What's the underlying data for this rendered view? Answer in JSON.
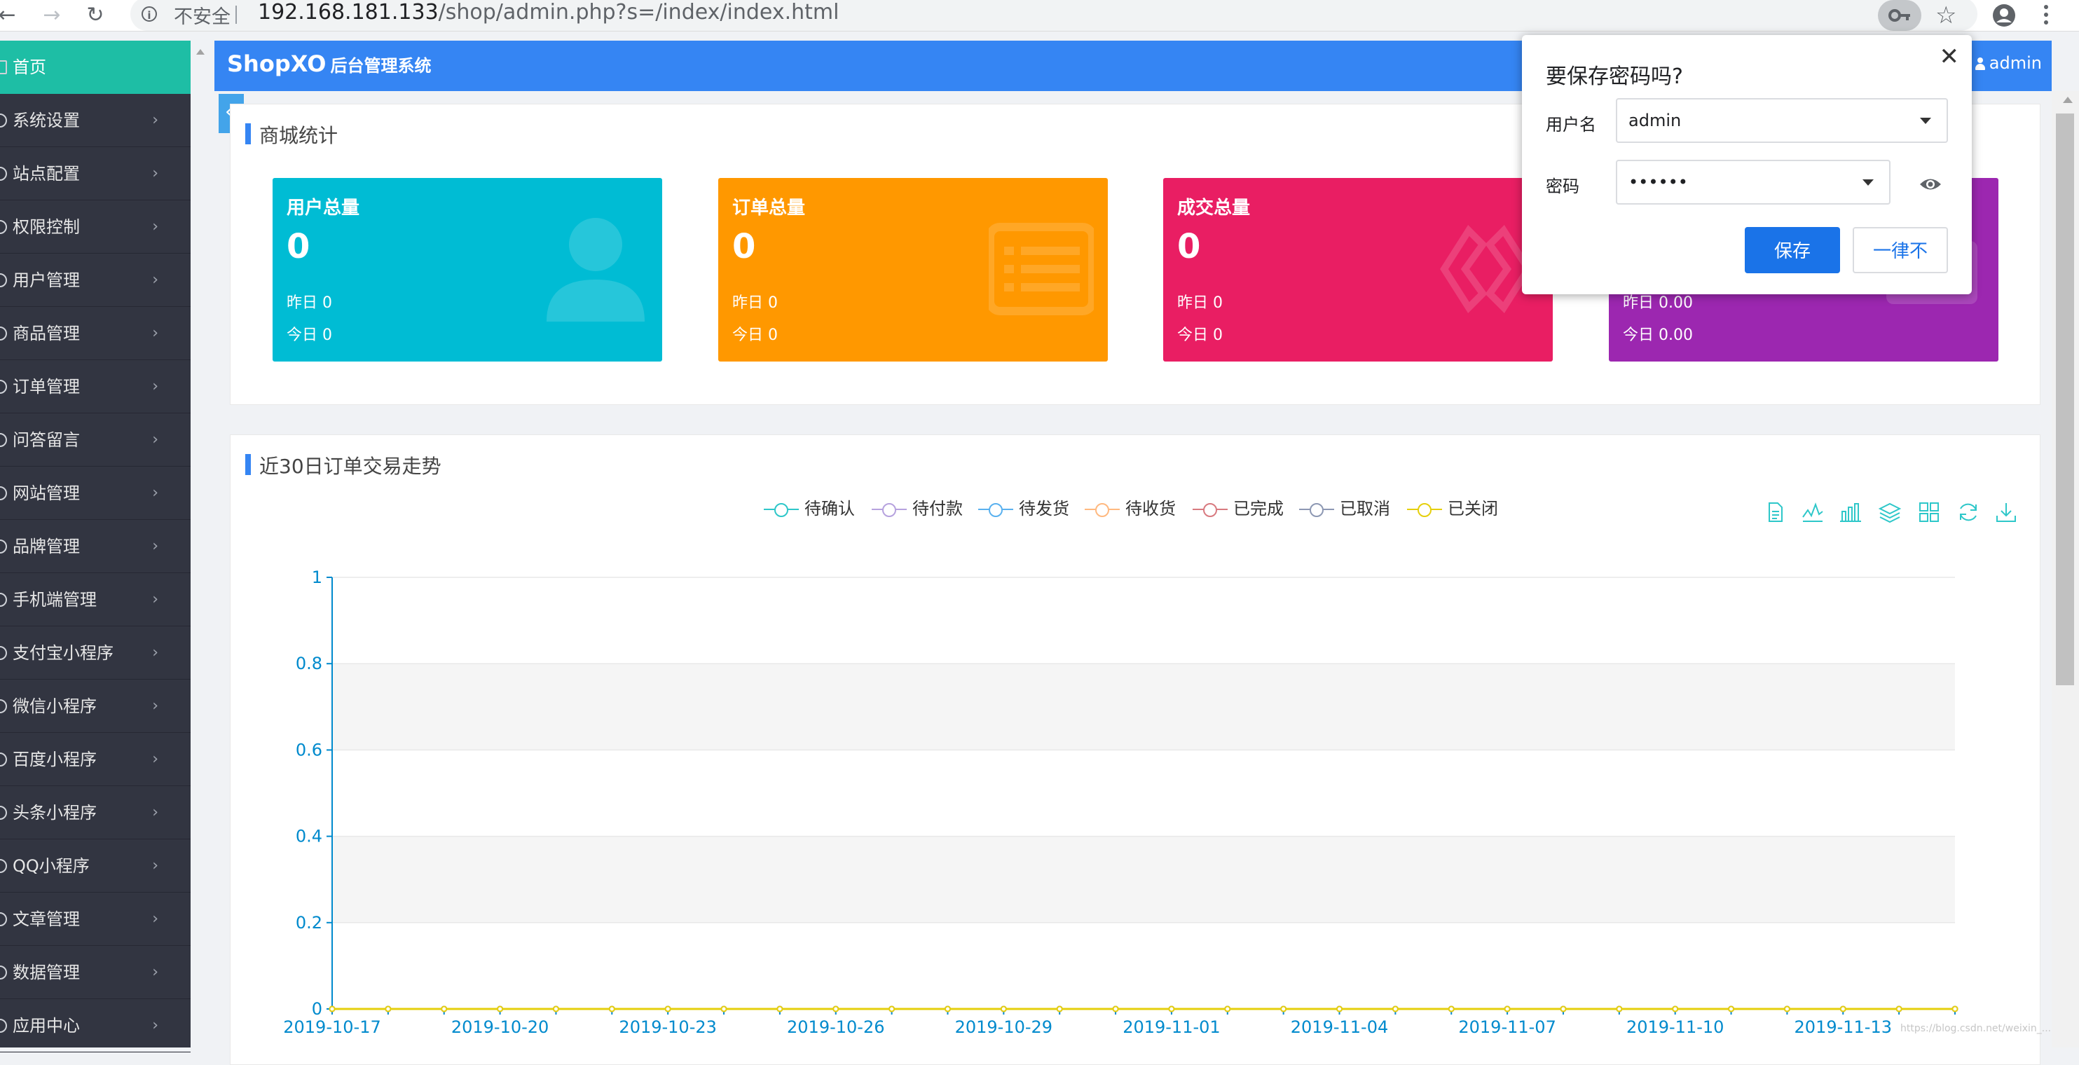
{
  "browser": {
    "insecure_label": "不安全",
    "url_host": "192.168.181.133",
    "url_path": "/shop/admin.php?s=/index/index.html"
  },
  "sidebar": {
    "items": [
      {
        "label": "首页",
        "active": true
      },
      {
        "label": "系统设置"
      },
      {
        "label": "站点配置"
      },
      {
        "label": "权限控制"
      },
      {
        "label": "用户管理"
      },
      {
        "label": "商品管理"
      },
      {
        "label": "订单管理"
      },
      {
        "label": "问答留言"
      },
      {
        "label": "网站管理"
      },
      {
        "label": "品牌管理"
      },
      {
        "label": "手机端管理"
      },
      {
        "label": "支付宝小程序"
      },
      {
        "label": "微信小程序"
      },
      {
        "label": "百度小程序"
      },
      {
        "label": "头条小程序"
      },
      {
        "label": "QQ小程序"
      },
      {
        "label": "文章管理"
      },
      {
        "label": "数据管理"
      },
      {
        "label": "应用中心"
      }
    ],
    "chevron": "›"
  },
  "header": {
    "brand": "ShopXO",
    "subtitle": "后台管理系统",
    "user": "admin"
  },
  "collapse_glyph": "«",
  "stats_panel": {
    "title": "商城统计",
    "cards": [
      {
        "title": "用户总量",
        "value": "0",
        "yesterday": "昨日 0",
        "today": "今日 0",
        "color": "#00bcd4",
        "icon": "user-icon"
      },
      {
        "title": "订单总量",
        "value": "0",
        "yesterday": "昨日 0",
        "today": "今日 0",
        "color": "#ff9800",
        "icon": "list-icon"
      },
      {
        "title": "成交总量",
        "value": "0",
        "yesterday": "昨日 0",
        "today": "今日 0",
        "color": "#e91e63",
        "icon": "deal-icon"
      },
      {
        "title": "",
        "value": "",
        "yesterday": "昨日 0.00",
        "today": "今日 0.00",
        "color": "#9c27b0",
        "icon": "money-icon"
      }
    ]
  },
  "trend_panel": {
    "title": "近30日订单交易走势"
  },
  "chart_data": {
    "type": "line",
    "title": "近30日订单交易走势",
    "xlabel": "",
    "ylabel": "",
    "ylim": [
      0,
      1
    ],
    "yticks": [
      "0",
      "0.2",
      "0.4",
      "0.6",
      "0.8",
      "1"
    ],
    "x_tick_labels": [
      "2019-10-17",
      "2019-10-20",
      "2019-10-23",
      "2019-10-26",
      "2019-10-29",
      "2019-11-01",
      "2019-11-04",
      "2019-11-07",
      "2019-11-10",
      "2019-11-13"
    ],
    "x": [
      "2019-10-17",
      "2019-10-18",
      "2019-10-19",
      "2019-10-20",
      "2019-10-21",
      "2019-10-22",
      "2019-10-23",
      "2019-10-24",
      "2019-10-25",
      "2019-10-26",
      "2019-10-27",
      "2019-10-28",
      "2019-10-29",
      "2019-10-30",
      "2019-10-31",
      "2019-11-01",
      "2019-11-02",
      "2019-11-03",
      "2019-11-04",
      "2019-11-05",
      "2019-11-06",
      "2019-11-07",
      "2019-11-08",
      "2019-11-09",
      "2019-11-10",
      "2019-11-11",
      "2019-11-12",
      "2019-11-13",
      "2019-11-14",
      "2019-11-15"
    ],
    "legend_position": "top-center",
    "grid": true,
    "series": [
      {
        "name": "待确认",
        "color": "#2ec7c9",
        "values": [
          0,
          0,
          0,
          0,
          0,
          0,
          0,
          0,
          0,
          0,
          0,
          0,
          0,
          0,
          0,
          0,
          0,
          0,
          0,
          0,
          0,
          0,
          0,
          0,
          0,
          0,
          0,
          0,
          0,
          0
        ]
      },
      {
        "name": "待付款",
        "color": "#b6a2de",
        "values": [
          0,
          0,
          0,
          0,
          0,
          0,
          0,
          0,
          0,
          0,
          0,
          0,
          0,
          0,
          0,
          0,
          0,
          0,
          0,
          0,
          0,
          0,
          0,
          0,
          0,
          0,
          0,
          0,
          0,
          0
        ]
      },
      {
        "name": "待发货",
        "color": "#5ab1ef",
        "values": [
          0,
          0,
          0,
          0,
          0,
          0,
          0,
          0,
          0,
          0,
          0,
          0,
          0,
          0,
          0,
          0,
          0,
          0,
          0,
          0,
          0,
          0,
          0,
          0,
          0,
          0,
          0,
          0,
          0,
          0
        ]
      },
      {
        "name": "待收货",
        "color": "#ffb980",
        "values": [
          0,
          0,
          0,
          0,
          0,
          0,
          0,
          0,
          0,
          0,
          0,
          0,
          0,
          0,
          0,
          0,
          0,
          0,
          0,
          0,
          0,
          0,
          0,
          0,
          0,
          0,
          0,
          0,
          0,
          0
        ]
      },
      {
        "name": "已完成",
        "color": "#d87a80",
        "values": [
          0,
          0,
          0,
          0,
          0,
          0,
          0,
          0,
          0,
          0,
          0,
          0,
          0,
          0,
          0,
          0,
          0,
          0,
          0,
          0,
          0,
          0,
          0,
          0,
          0,
          0,
          0,
          0,
          0,
          0
        ]
      },
      {
        "name": "已取消",
        "color": "#8d98b3",
        "values": [
          0,
          0,
          0,
          0,
          0,
          0,
          0,
          0,
          0,
          0,
          0,
          0,
          0,
          0,
          0,
          0,
          0,
          0,
          0,
          0,
          0,
          0,
          0,
          0,
          0,
          0,
          0,
          0,
          0,
          0
        ]
      },
      {
        "name": "已关闭",
        "color": "#e5cf0d",
        "values": [
          0,
          0,
          0,
          0,
          0,
          0,
          0,
          0,
          0,
          0,
          0,
          0,
          0,
          0,
          0,
          0,
          0,
          0,
          0,
          0,
          0,
          0,
          0,
          0,
          0,
          0,
          0,
          0,
          0,
          0
        ]
      }
    ],
    "toolbox_color": "#2ec7c9"
  },
  "password_dialog": {
    "title": "要保存密码吗?",
    "username_label": "用户名",
    "username_value": "admin",
    "password_label": "密码",
    "password_value": "••••••",
    "save_label": "保存",
    "never_label": "一律不",
    "close_glyph": "✕"
  },
  "watermark": "https://blog.csdn.net/weixin_..."
}
